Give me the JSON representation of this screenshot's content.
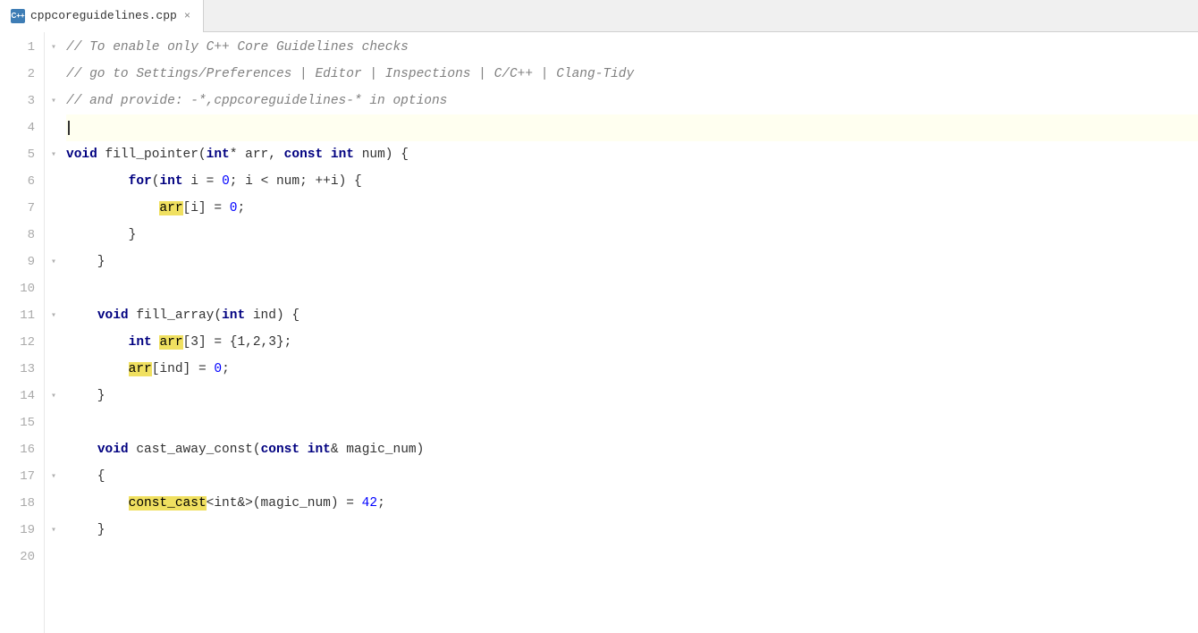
{
  "tab": {
    "icon_label": "C++",
    "filename": "cppcoreguidelines.cpp",
    "close_label": "×"
  },
  "lines": [
    {
      "num": 1,
      "fold": "▾",
      "content": [
        {
          "t": "cm",
          "v": "// To enable only C++ Core Guidelines checks"
        }
      ]
    },
    {
      "num": 2,
      "fold": "",
      "content": [
        {
          "t": "cm",
          "v": "// go to Settings/Preferences | Editor | Inspections | C/C++ | Clang-Tidy"
        }
      ]
    },
    {
      "num": 3,
      "fold": "▾",
      "content": [
        {
          "t": "cm",
          "v": "// and provide: -*,cppcoreguidelines-* in options"
        }
      ]
    },
    {
      "num": 4,
      "fold": "",
      "content": [],
      "active": true
    },
    {
      "num": 5,
      "fold": "▾",
      "content": [
        {
          "t": "kw",
          "v": "void"
        },
        {
          "t": "plain",
          "v": " fill_pointer("
        },
        {
          "t": "kw",
          "v": "int"
        },
        {
          "t": "plain",
          "v": "* arr, "
        },
        {
          "t": "kw",
          "v": "const"
        },
        {
          "t": "plain",
          "v": " "
        },
        {
          "t": "kw",
          "v": "int"
        },
        {
          "t": "plain",
          "v": " num) {"
        }
      ]
    },
    {
      "num": 6,
      "fold": "",
      "content": [
        {
          "t": "plain",
          "v": "        "
        },
        {
          "t": "kw",
          "v": "for"
        },
        {
          "t": "plain",
          "v": "("
        },
        {
          "t": "kw",
          "v": "int"
        },
        {
          "t": "plain",
          "v": " i = "
        },
        {
          "t": "num",
          "v": "0"
        },
        {
          "t": "plain",
          "v": "; i < num; ++i) {"
        }
      ]
    },
    {
      "num": 7,
      "fold": "",
      "content": [
        {
          "t": "plain",
          "v": "            "
        },
        {
          "t": "hl",
          "v": "arr"
        },
        {
          "t": "plain",
          "v": "[i] = "
        },
        {
          "t": "num",
          "v": "0"
        },
        {
          "t": "plain",
          "v": ";"
        }
      ]
    },
    {
      "num": 8,
      "fold": "",
      "content": [
        {
          "t": "plain",
          "v": "        }"
        }
      ]
    },
    {
      "num": 9,
      "fold": "▾",
      "content": [
        {
          "t": "plain",
          "v": "    }"
        }
      ]
    },
    {
      "num": 10,
      "fold": "",
      "content": []
    },
    {
      "num": 11,
      "fold": "▾",
      "content": [
        {
          "t": "plain",
          "v": "    "
        },
        {
          "t": "kw",
          "v": "void"
        },
        {
          "t": "plain",
          "v": " fill_array("
        },
        {
          "t": "kw",
          "v": "int"
        },
        {
          "t": "plain",
          "v": " ind) {"
        }
      ]
    },
    {
      "num": 12,
      "fold": "",
      "content": [
        {
          "t": "plain",
          "v": "        "
        },
        {
          "t": "kw",
          "v": "int"
        },
        {
          "t": "plain",
          "v": " "
        },
        {
          "t": "hl",
          "v": "arr"
        },
        {
          "t": "plain",
          "v": "[3] = {1,2,3};"
        }
      ]
    },
    {
      "num": 13,
      "fold": "",
      "content": [
        {
          "t": "plain",
          "v": "        "
        },
        {
          "t": "hl",
          "v": "arr"
        },
        {
          "t": "plain",
          "v": "[ind] = "
        },
        {
          "t": "num",
          "v": "0"
        },
        {
          "t": "plain",
          "v": ";"
        }
      ]
    },
    {
      "num": 14,
      "fold": "▾",
      "content": [
        {
          "t": "plain",
          "v": "    }"
        }
      ]
    },
    {
      "num": 15,
      "fold": "",
      "content": []
    },
    {
      "num": 16,
      "fold": "",
      "content": [
        {
          "t": "plain",
          "v": "    "
        },
        {
          "t": "kw",
          "v": "void"
        },
        {
          "t": "plain",
          "v": " cast_away_const("
        },
        {
          "t": "kw",
          "v": "const"
        },
        {
          "t": "plain",
          "v": " "
        },
        {
          "t": "kw",
          "v": "int"
        },
        {
          "t": "plain",
          "v": "& magic_num)"
        }
      ]
    },
    {
      "num": 17,
      "fold": "▾",
      "content": [
        {
          "t": "plain",
          "v": "    {"
        }
      ]
    },
    {
      "num": 18,
      "fold": "",
      "content": [
        {
          "t": "plain",
          "v": "        "
        },
        {
          "t": "hl",
          "v": "const_cast"
        },
        {
          "t": "plain",
          "v": "<int&>(magic_num) = "
        },
        {
          "t": "num",
          "v": "42"
        },
        {
          "t": "plain",
          "v": ";"
        }
      ]
    },
    {
      "num": 19,
      "fold": "▾",
      "content": [
        {
          "t": "plain",
          "v": "    }"
        }
      ]
    },
    {
      "num": 20,
      "fold": "",
      "content": []
    }
  ]
}
